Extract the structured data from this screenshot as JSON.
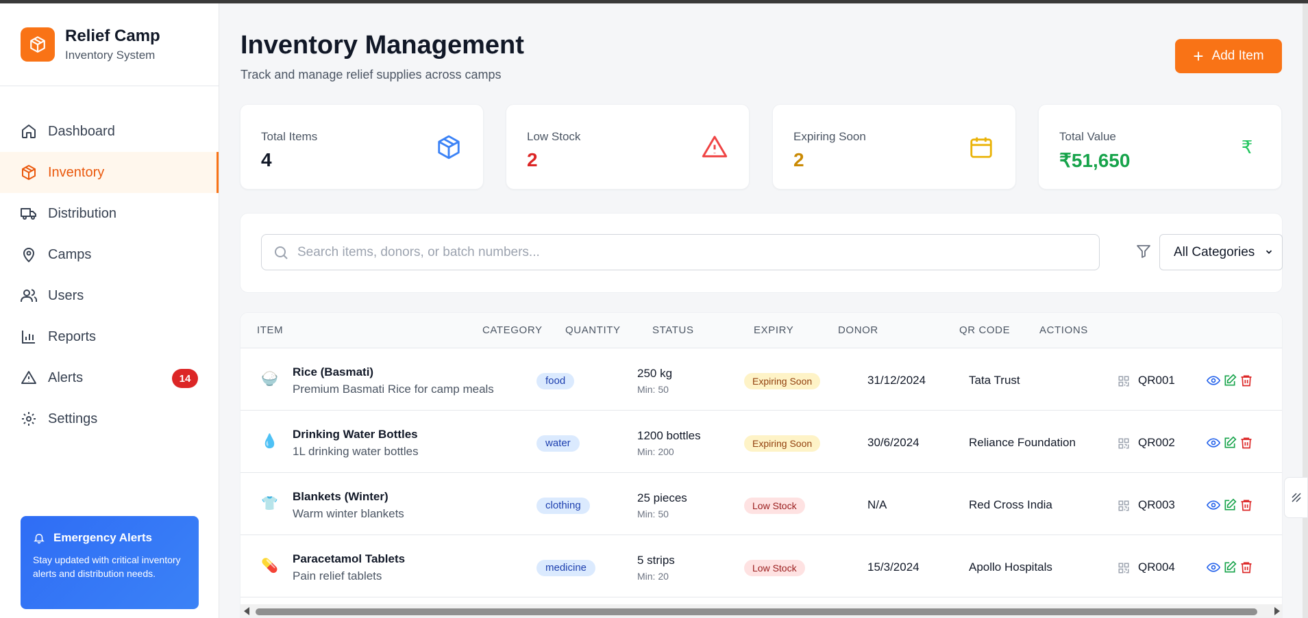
{
  "brand": {
    "title": "Relief Camp",
    "subtitle": "Inventory System",
    "accent": "#f97316"
  },
  "nav": {
    "items": [
      {
        "label": "Dashboard",
        "icon": "home-icon"
      },
      {
        "label": "Inventory",
        "icon": "package-icon",
        "active": true
      },
      {
        "label": "Distribution",
        "icon": "truck-icon"
      },
      {
        "label": "Camps",
        "icon": "map-pin-icon"
      },
      {
        "label": "Users",
        "icon": "users-icon"
      },
      {
        "label": "Reports",
        "icon": "bar-chart-icon"
      },
      {
        "label": "Alerts",
        "icon": "alert-triangle-icon",
        "badge": "14"
      },
      {
        "label": "Settings",
        "icon": "gear-icon"
      }
    ]
  },
  "emergency": {
    "title": "Emergency Alerts",
    "text": "Stay updated with critical inventory alerts and distribution needs."
  },
  "header": {
    "title": "Inventory Management",
    "subtitle": "Track and manage relief supplies across camps",
    "add_label": "Add Item"
  },
  "stats": [
    {
      "label": "Total Items",
      "value": "4",
      "color": "#111827",
      "icon": "package-icon"
    },
    {
      "label": "Low Stock",
      "value": "2",
      "color": "#dc2626",
      "icon": "alert-triangle-icon"
    },
    {
      "label": "Expiring Soon",
      "value": "2",
      "color": "#ca8a04",
      "icon": "calendar-icon"
    },
    {
      "label": "Total Value",
      "value": "₹51,650",
      "color": "#16a34a",
      "icon": "rupee-icon"
    }
  ],
  "filters": {
    "search_placeholder": "Search items, donors, or batch numbers...",
    "category_selected": "All Categories"
  },
  "table": {
    "headers": [
      "ITEM",
      "CATEGORY",
      "QUANTITY",
      "STATUS",
      "EXPIRY",
      "DONOR",
      "QR CODE",
      "ACTIONS"
    ],
    "rows": [
      {
        "icon": "🍚",
        "name": "Rice (Basmati)",
        "desc": "Premium Basmati Rice for camp meals",
        "category": "food",
        "qty": "250 kg",
        "min": "Min: 50",
        "status": "Expiring Soon",
        "status_type": "expiring",
        "expiry": "31/12/2024",
        "donor": "Tata Trust",
        "qr": "QR001"
      },
      {
        "icon": "💧",
        "name": "Drinking Water Bottles",
        "desc": "1L drinking water bottles",
        "category": "water",
        "qty": "1200 bottles",
        "min": "Min: 200",
        "status": "Expiring Soon",
        "status_type": "expiring",
        "expiry": "30/6/2024",
        "donor": "Reliance Foundation",
        "qr": "QR002"
      },
      {
        "icon": "👕",
        "name": "Blankets (Winter)",
        "desc": "Warm winter blankets",
        "category": "clothing",
        "qty": "25 pieces",
        "min": "Min: 50",
        "status": "Low Stock",
        "status_type": "low",
        "expiry": "N/A",
        "donor": "Red Cross India",
        "qr": "QR003"
      },
      {
        "icon": "💊",
        "name": "Paracetamol Tablets",
        "desc": "Pain relief tablets",
        "category": "medicine",
        "qty": "5 strips",
        "min": "Min: 20",
        "status": "Low Stock",
        "status_type": "low",
        "expiry": "15/3/2024",
        "donor": "Apollo Hospitals",
        "qr": "QR004"
      }
    ]
  }
}
